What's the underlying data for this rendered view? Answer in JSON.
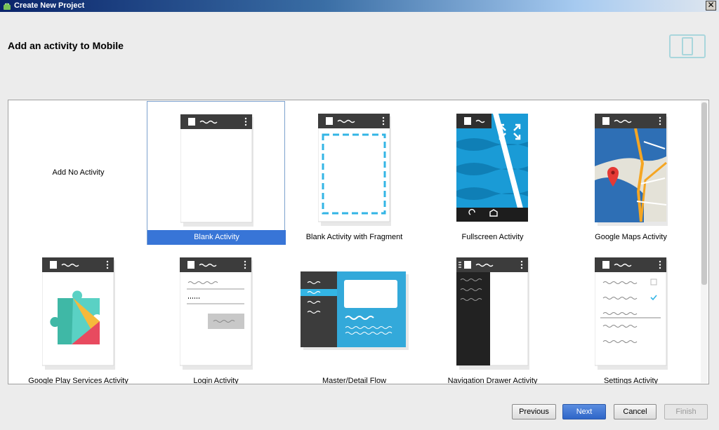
{
  "window": {
    "title": "Create New Project",
    "close_glyph": "✕"
  },
  "header": {
    "heading": "Add an activity to Mobile"
  },
  "gallery": {
    "tiles": [
      {
        "label": "Add No Activity"
      },
      {
        "label": "Blank Activity"
      },
      {
        "label": "Blank Activity with Fragment"
      },
      {
        "label": "Fullscreen Activity"
      },
      {
        "label": "Google Maps Activity"
      },
      {
        "label": "Google Play Services Activity"
      },
      {
        "label": "Login Activity"
      },
      {
        "label": "Master/Detail Flow"
      },
      {
        "label": "Navigation Drawer Activity"
      },
      {
        "label": "Settings Activity"
      }
    ],
    "selected_index": 1
  },
  "buttons": {
    "previous": "Previous",
    "next": "Next",
    "cancel": "Cancel",
    "finish": "Finish"
  },
  "colors": {
    "accent": "#3875d7",
    "phone_bar": "#3c3c3c",
    "holo_blue": "#33b5e5"
  }
}
